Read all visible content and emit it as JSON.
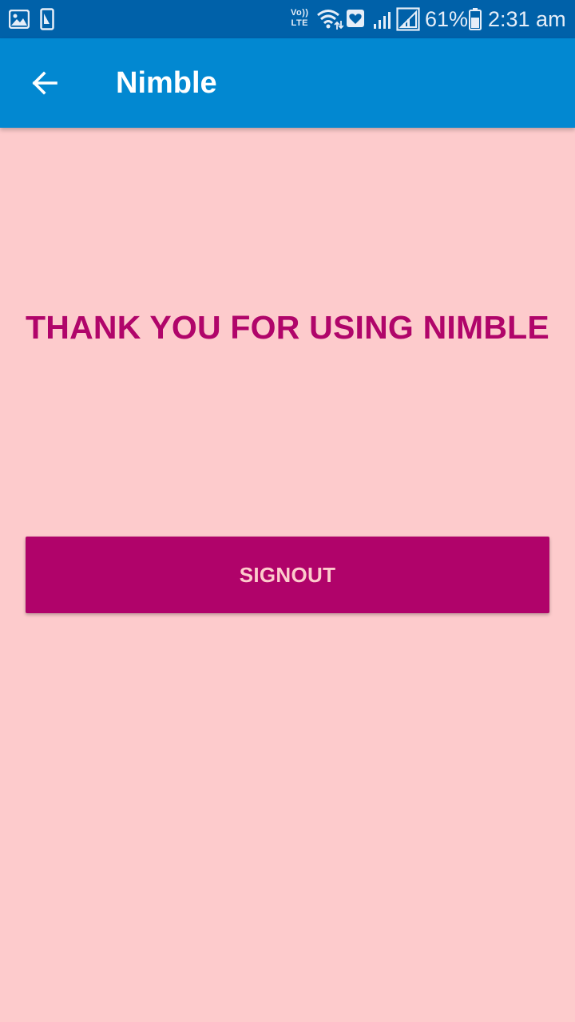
{
  "status_bar": {
    "icons_left": [
      "gallery-icon",
      "screenshot-icon"
    ],
    "volte_line1": "Vo))",
    "volte_line2": "LTE",
    "icons_right": [
      "wifi-icon",
      "notification-heart-icon",
      "signal-icon",
      "signal-2-icon",
      "battery-icon"
    ],
    "battery_percent": "61%",
    "time": "2:31 am"
  },
  "app_bar": {
    "title": "Nimble",
    "back_icon": "arrow-back-icon"
  },
  "main": {
    "message": "THANK YOU FOR USING NIMBLE",
    "signout_label": "SIGNOUT"
  },
  "colors": {
    "status_bar": "#0061a9",
    "app_bar": "#0288d1",
    "background": "#fdcbcc",
    "accent": "#b0036a"
  }
}
